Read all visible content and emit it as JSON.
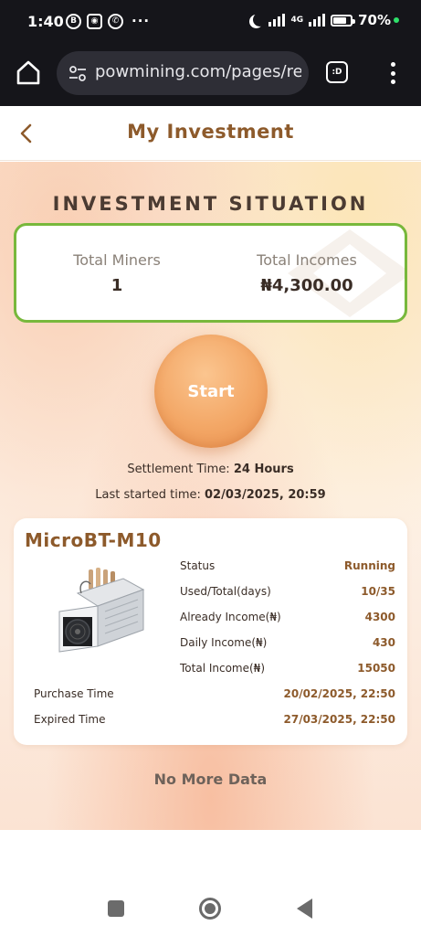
{
  "status_bar": {
    "time": "1:40",
    "left_icons": [
      "b-circle-icon",
      "discord-icon",
      "whatsapp-icon",
      "more-dots-icon"
    ],
    "dots": "···",
    "network": "4G",
    "battery": "70%"
  },
  "browser": {
    "url": "powmining.com/pages/reco",
    "tab_label": ":D"
  },
  "header": {
    "title": "My Investment"
  },
  "investment": {
    "section_title": "INVESTMENT SITUATION",
    "total_miners_label": "Total Miners",
    "total_miners_value": "1",
    "total_incomes_label": "Total Incomes",
    "total_incomes_value": "₦4,300.00",
    "start_label": "Start",
    "settlement_label": "Settlement Time:",
    "settlement_value": "24 Hours",
    "last_started_label": "Last started time:",
    "last_started_value": "02/03/2025, 20:59"
  },
  "miner": {
    "name": "MicroBT-M10",
    "rows": [
      {
        "label": "Status",
        "value": "Running"
      },
      {
        "label": "Used/Total(days)",
        "value": "10/35"
      },
      {
        "label": "Already Income(₦)",
        "value": "4300"
      },
      {
        "label": "Daily Income(₦)",
        "value": "430"
      },
      {
        "label": "Total Income(₦)",
        "value": "15050"
      }
    ],
    "purchase_label": "Purchase Time",
    "purchase_value": "20/02/2025, 22:50",
    "expired_label": "Expired Time",
    "expired_value": "27/03/2025, 22:50"
  },
  "footer": {
    "no_more": "No More Data"
  },
  "colors": {
    "brand_brown": "#8d5a2b",
    "card_border_green": "#78b83c",
    "start_orange": "#f3a766"
  }
}
